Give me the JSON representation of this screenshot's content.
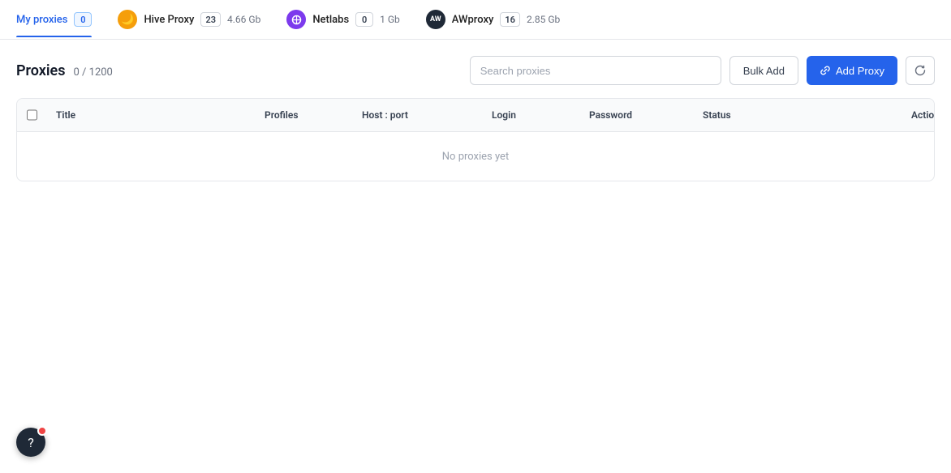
{
  "tabs": [
    {
      "id": "my-proxies",
      "label": "My proxies",
      "badge": "0",
      "size": null,
      "active": true,
      "icon": null
    },
    {
      "id": "hive-proxy",
      "label": "Hive Proxy",
      "badge": "23",
      "size": "4.66 Gb",
      "active": false,
      "icon": "hive"
    },
    {
      "id": "netlabs",
      "label": "Netlabs",
      "badge": "0",
      "size": "1 Gb",
      "active": false,
      "icon": "netlabs"
    },
    {
      "id": "awproxy",
      "label": "AWproxy",
      "badge": "16",
      "size": "2.85 Gb",
      "active": false,
      "icon": "awproxy"
    }
  ],
  "proxies": {
    "title": "Proxies",
    "count_label": "0 / 1200",
    "search_placeholder": "Search proxies",
    "bulk_add_label": "Bulk Add",
    "add_proxy_label": "Add Proxy",
    "no_data_text": "No proxies yet"
  },
  "table": {
    "columns": [
      {
        "id": "checkbox",
        "label": ""
      },
      {
        "id": "title",
        "label": "Title"
      },
      {
        "id": "profiles",
        "label": "Profiles"
      },
      {
        "id": "host_port",
        "label": "Host : port"
      },
      {
        "id": "login",
        "label": "Login"
      },
      {
        "id": "password",
        "label": "Password"
      },
      {
        "id": "status",
        "label": "Status"
      },
      {
        "id": "actions",
        "label": "Actions"
      }
    ]
  },
  "help": {
    "icon": "?"
  }
}
